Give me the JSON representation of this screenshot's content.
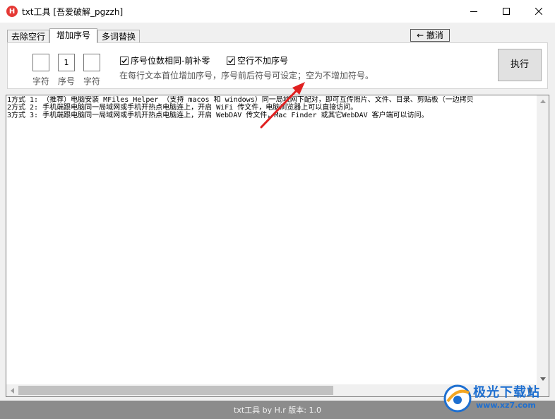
{
  "window": {
    "title": "txt工具 [吾爱破解_pgzzh]",
    "icon_letter": "H"
  },
  "tabs": [
    {
      "label": "去除空行",
      "active": false
    },
    {
      "label": "增加序号",
      "active": true
    },
    {
      "label": "多词替换",
      "active": false
    }
  ],
  "toolbar": {
    "undo_label": "← 撤消"
  },
  "panel": {
    "prefix_value": "",
    "prefix_label": "字符",
    "seq_value": "1",
    "seq_label": "序号",
    "suffix_value": "",
    "suffix_label": "字符",
    "option_pad_zero": {
      "label": "序号位数相同-前补零",
      "checked": true
    },
    "option_skip_blank": {
      "label": "空行不加序号",
      "checked": true
    },
    "hint": "在每行文本首位增加序号，序号前后符号可设定；空为不增加符号。",
    "execute_label": "执行"
  },
  "content": {
    "lines": [
      "1方式 1: （推荐）电脑安装 MFiles Helper （支持 macos 和 windows）同一局域网下配对，即可互传照片、文件、目录、剪贴板（一边拷贝",
      "2方式 2: 手机端跟电脑同一局域网或手机开热点电脑连上，开启 WiFi 传文件，电脑浏览器上可以直接访问。",
      "3方式 3: 手机端跟电脑同一局域网或手机开热点电脑连上，开启 WebDAV 传文件，Mac Finder 或其它WebDAV 客户端可以访问。"
    ]
  },
  "status": {
    "text": "txt工具 by H.r  版本: 1.0"
  },
  "watermark": {
    "brand": "极光下载站",
    "url": "www.xz7.com"
  },
  "colors": {
    "accent_red": "#e53935",
    "status_bg": "#8c8c8c",
    "watermark_blue": "#1e6fd0"
  }
}
